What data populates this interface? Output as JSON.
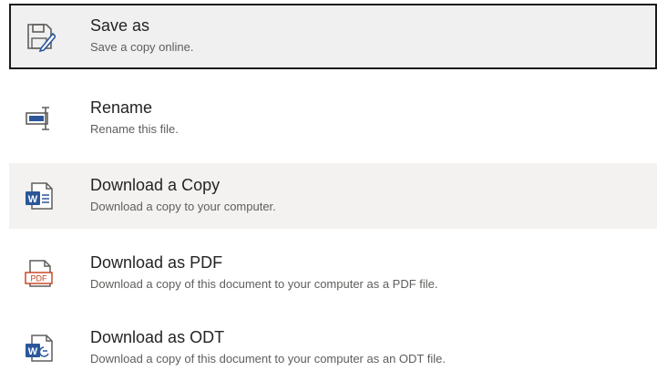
{
  "menu": {
    "items": [
      {
        "icon": "save-as-icon",
        "title": "Save as",
        "desc": "Save a copy online."
      },
      {
        "icon": "rename-icon",
        "title": "Rename",
        "desc": "Rename this file."
      },
      {
        "icon": "word-document-icon",
        "title": "Download a Copy",
        "desc": "Download a copy to your computer."
      },
      {
        "icon": "pdf-document-icon",
        "title": "Download as PDF",
        "desc": "Download a copy of this document to your computer as a PDF file."
      },
      {
        "icon": "odt-document-icon",
        "title": "Download as ODT",
        "desc": "Download a copy of this document to your computer as an ODT file."
      }
    ],
    "pdf_badge": "PDF",
    "word_badge": "W",
    "colors": {
      "accent": "#2b579a",
      "pdf_red": "#c43e1c",
      "selected_bg": "#f0f0f0",
      "hover_bg": "#f3f2f1"
    }
  }
}
